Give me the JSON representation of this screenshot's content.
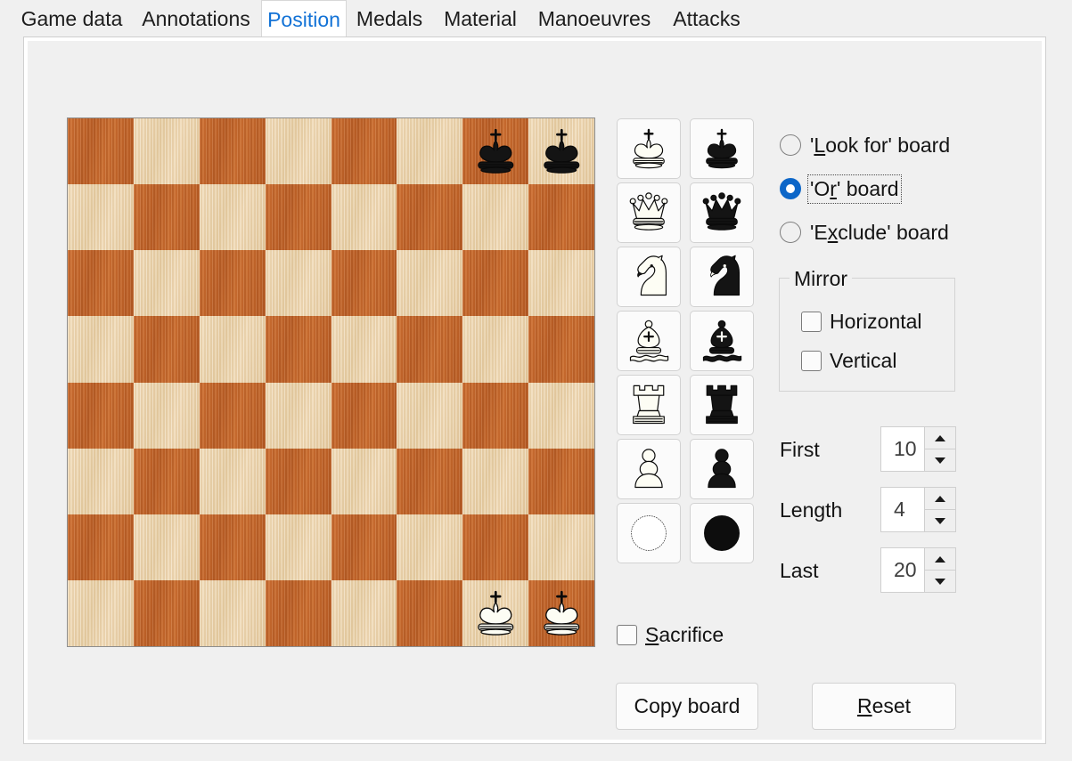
{
  "tabs": [
    {
      "label": "Game data",
      "active": false
    },
    {
      "label": "Annotations",
      "active": false
    },
    {
      "label": "Position",
      "active": true
    },
    {
      "label": "Medals",
      "active": false
    },
    {
      "label": "Material",
      "active": false
    },
    {
      "label": "Manoeuvres",
      "active": false
    },
    {
      "label": "Attacks",
      "active": false
    }
  ],
  "board": {
    "squares": 8,
    "light_color": "#edd7b1",
    "dark_color": "#c86a2d",
    "pieces": [
      {
        "square": "g8",
        "piece": "king",
        "color": "black"
      },
      {
        "square": "h8",
        "piece": "king",
        "color": "black"
      },
      {
        "square": "g1",
        "piece": "king",
        "color": "white"
      },
      {
        "square": "h1",
        "piece": "king",
        "color": "white"
      }
    ]
  },
  "palette": [
    {
      "piece": "king",
      "color": "white"
    },
    {
      "piece": "king",
      "color": "black"
    },
    {
      "piece": "queen",
      "color": "white"
    },
    {
      "piece": "queen",
      "color": "black"
    },
    {
      "piece": "knight",
      "color": "white"
    },
    {
      "piece": "knight",
      "color": "black"
    },
    {
      "piece": "bishop",
      "color": "white"
    },
    {
      "piece": "bishop",
      "color": "black"
    },
    {
      "piece": "rook",
      "color": "white"
    },
    {
      "piece": "rook",
      "color": "black"
    },
    {
      "piece": "pawn",
      "color": "white"
    },
    {
      "piece": "pawn",
      "color": "black"
    },
    {
      "piece": "any",
      "color": "white"
    },
    {
      "piece": "any",
      "color": "black"
    }
  ],
  "radios": [
    {
      "label_pre": "'",
      "mnemonic": "L",
      "label_post": "ook for' board",
      "selected": false,
      "focused": false
    },
    {
      "label_pre": "'O",
      "mnemonic": "r",
      "label_post": "' board",
      "selected": true,
      "focused": true
    },
    {
      "label_pre": "'E",
      "mnemonic": "x",
      "label_post": "clude' board",
      "selected": false,
      "focused": false
    }
  ],
  "mirror": {
    "legend": "Mirror",
    "horizontal": {
      "label": "Horizontal",
      "checked": false
    },
    "vertical": {
      "label": "Vertical",
      "checked": false
    }
  },
  "spinners": [
    {
      "label": "First",
      "value": "10"
    },
    {
      "label": "Length",
      "value": "4"
    },
    {
      "label": "Last",
      "value": "20"
    }
  ],
  "sacrifice": {
    "mnemonic": "S",
    "label_post": "acrifice",
    "checked": false
  },
  "buttons": {
    "copy_board": "Copy board",
    "reset_pre": "",
    "reset_mnemonic": "R",
    "reset_post": "eset"
  },
  "colors": {
    "accent": "#1272d6",
    "radio_selected": "#0c66c8",
    "panel_bg": "#f0f0f0",
    "tab_active_bg": "#ffffff"
  }
}
